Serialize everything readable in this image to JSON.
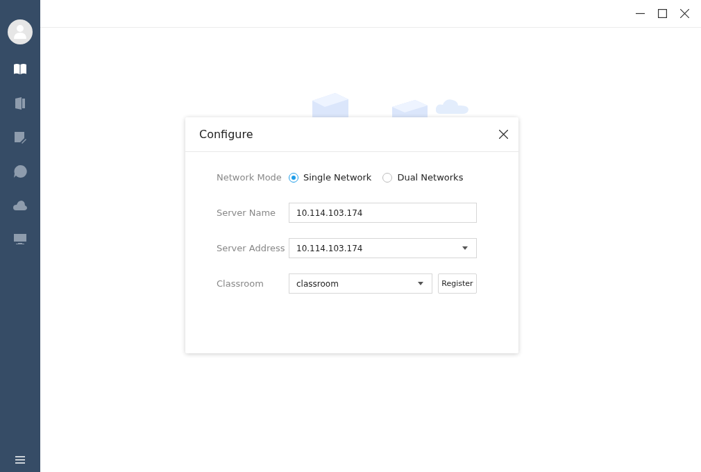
{
  "sidebar": {
    "items": [
      {
        "kind": "book",
        "selected": true
      },
      {
        "kind": "door",
        "selected": false
      },
      {
        "kind": "note",
        "selected": false
      },
      {
        "kind": "chat",
        "selected": false
      },
      {
        "kind": "cloud",
        "selected": false
      },
      {
        "kind": "monitor",
        "selected": false
      }
    ]
  },
  "dialog": {
    "title": "Configure",
    "network_mode": {
      "label": "Network Mode",
      "options": [
        {
          "label": "Single Network",
          "selected": true
        },
        {
          "label": "Dual Networks",
          "selected": false
        }
      ]
    },
    "server_name": {
      "label": "Server Name",
      "value": "10.114.103.174"
    },
    "server_address": {
      "label": "Server Address",
      "value": "10.114.103.174"
    },
    "classroom": {
      "label": "Classroom",
      "value": "classroom",
      "button": "Register"
    }
  }
}
